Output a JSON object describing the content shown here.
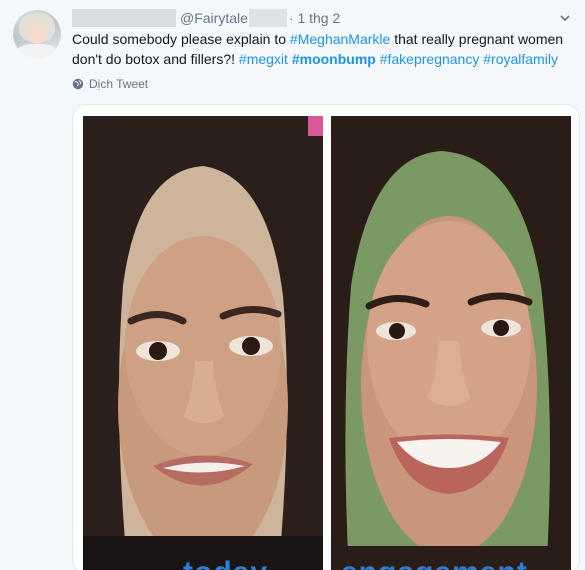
{
  "tweet": {
    "handle": "@Fairytale",
    "time": "· 1 thg 2",
    "text_line1_plain": "Could somebody please explain to ",
    "text_line1_tag": "#MeghanMarkle",
    "text_line1_rest": " that really pregnant women",
    "text_line2_plain": "don't do botox and fillers?! ",
    "hashtags": [
      "#megxit",
      "#moonbump",
      "#fakepregnancy",
      "#royalfamily"
    ],
    "translate_label": "Dịch Tweet"
  },
  "media": {
    "left_watermark": "today",
    "right_watermark": "engagement"
  },
  "colors": {
    "link": "#1b95e0",
    "secondary_text": "#657786",
    "background": "#f5f8fa"
  }
}
